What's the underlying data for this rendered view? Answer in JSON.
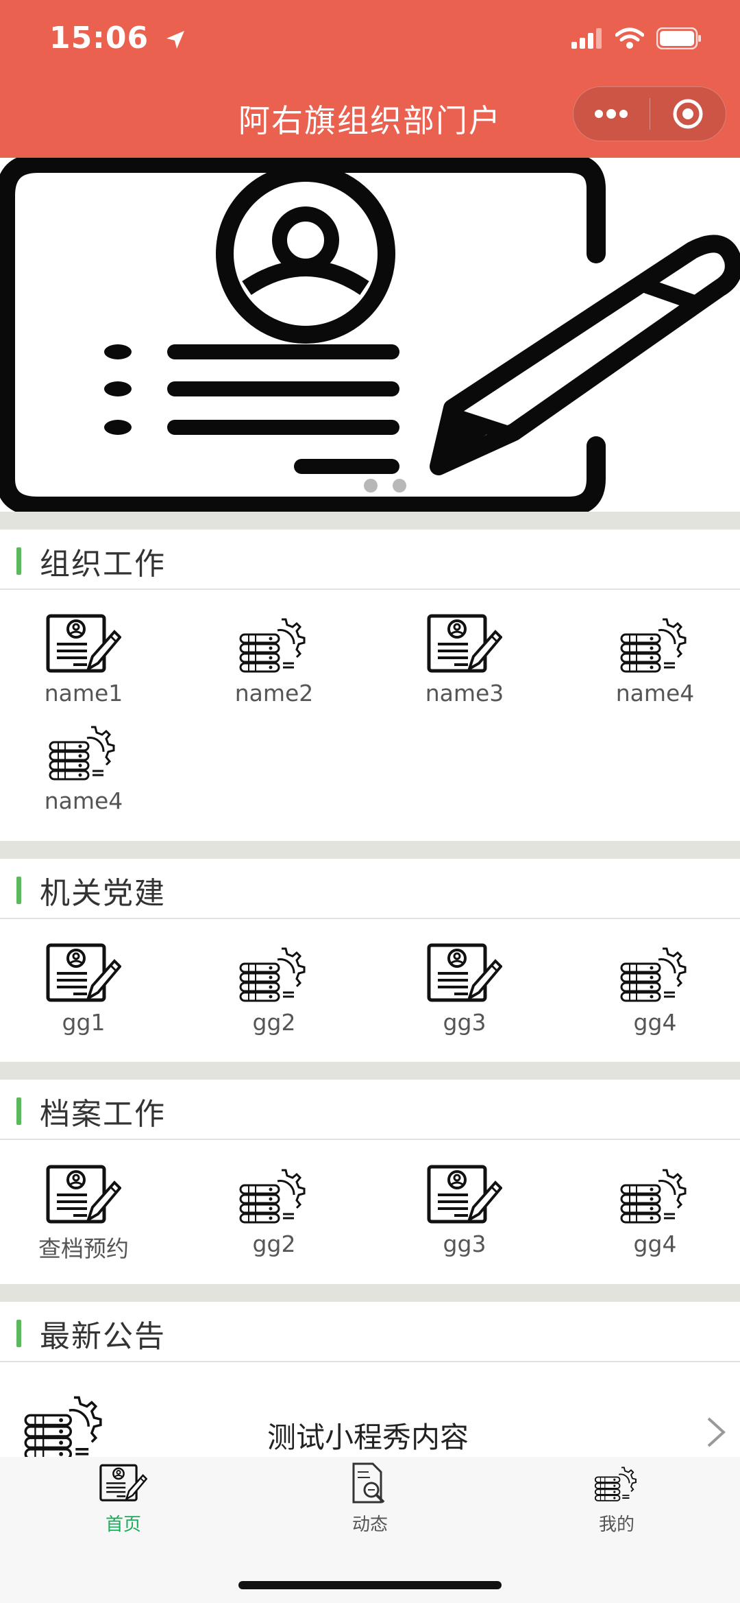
{
  "status_bar": {
    "time": "15:06"
  },
  "nav": {
    "title": "阿右旗组织部门户"
  },
  "sections": [
    {
      "title": "组织工作",
      "items": [
        "name1",
        "name2",
        "name3",
        "name4",
        "name4"
      ]
    },
    {
      "title": "机关党建",
      "items": [
        "gg1",
        "gg2",
        "gg3",
        "gg4"
      ]
    },
    {
      "title": "档案工作",
      "items": [
        "查档预约",
        "gg2",
        "gg3",
        "gg4"
      ]
    },
    {
      "title": "最新公告"
    }
  ],
  "notice": {
    "text": "测试小程秀内容"
  },
  "tabbar": {
    "items": [
      {
        "label": "首页",
        "icon": "document-edit-icon",
        "active": true
      },
      {
        "label": "动态",
        "icon": "search-document-icon",
        "active": false
      },
      {
        "label": "我的",
        "icon": "gear-server-icon",
        "active": false
      }
    ]
  },
  "colors": {
    "header": "#ea6150",
    "accent_green": "#5cb85c",
    "tab_active": "#1aad5b"
  }
}
